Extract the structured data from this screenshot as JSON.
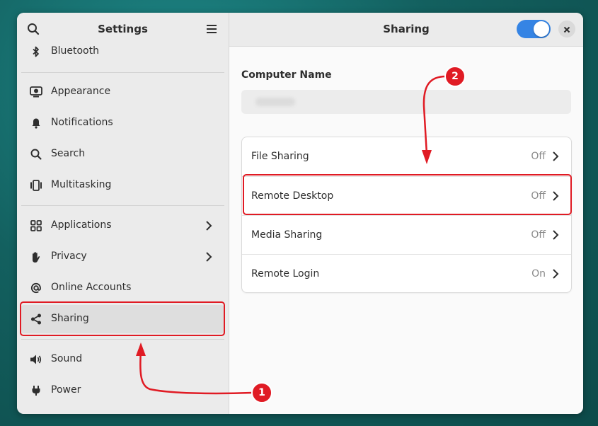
{
  "sidebar": {
    "title": "Settings",
    "items": [
      {
        "label": "Bluetooth",
        "icon": "bluetooth-icon"
      },
      {
        "label": "Appearance",
        "icon": "appearance-icon"
      },
      {
        "label": "Notifications",
        "icon": "bell-icon"
      },
      {
        "label": "Search",
        "icon": "search-icon"
      },
      {
        "label": "Multitasking",
        "icon": "multitasking-icon"
      },
      {
        "label": "Applications",
        "icon": "grid-icon"
      },
      {
        "label": "Privacy",
        "icon": "hand-icon"
      },
      {
        "label": "Online Accounts",
        "icon": "at-icon"
      },
      {
        "label": "Sharing",
        "icon": "share-icon"
      },
      {
        "label": "Sound",
        "icon": "speaker-icon"
      },
      {
        "label": "Power",
        "icon": "plug-icon"
      }
    ]
  },
  "main": {
    "title": "Sharing",
    "sharing_enabled": true,
    "computer_name_label": "Computer Name",
    "computer_name_value": "",
    "rows": [
      {
        "label": "File Sharing",
        "value": "Off"
      },
      {
        "label": "Remote Desktop",
        "value": "Off"
      },
      {
        "label": "Media Sharing",
        "value": "Off"
      },
      {
        "label": "Remote Login",
        "value": "On"
      }
    ]
  },
  "annotations": {
    "step1": "1",
    "step2": "2",
    "color": "#e01b24"
  },
  "colors": {
    "accent": "#3584e4",
    "sidebar_bg": "#ebebeb",
    "window_bg": "#fafafa"
  }
}
